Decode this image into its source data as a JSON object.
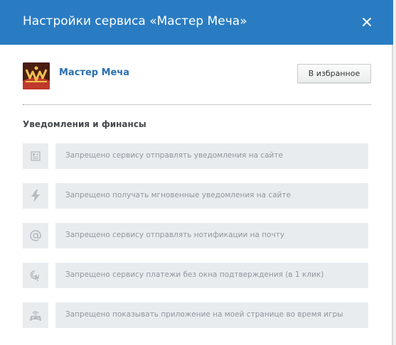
{
  "dialog": {
    "title": "Настройки сервиса «Мастер Меча»",
    "close_icon": "close-icon"
  },
  "app": {
    "name": "Мастер Меча",
    "logo_icon": "app-logo-icon",
    "favorite_label": "В избранное"
  },
  "section": {
    "title": "Уведомления и финансы"
  },
  "permissions": [
    {
      "icon": "notification-list-icon",
      "label": "Запрещено сервису отправлять уведомления на сайте"
    },
    {
      "icon": "lightning-icon",
      "label": "Запрещено получать мгновенные уведомления на сайте"
    },
    {
      "icon": "at-sign-icon",
      "label": "Запрещено сервису отправлять нотификации на почту"
    },
    {
      "icon": "one-click-payment-icon",
      "label": "Запрещено сервису платежи без окна подтверждения (в 1 клик)"
    },
    {
      "icon": "gamepad-icon",
      "label": "Запрещено показывать приложение на моей странице во время игры"
    }
  ],
  "colors": {
    "header": "#2a7cc2",
    "link": "#2a6fb0",
    "row_background": "#e9ecef",
    "row_text": "#8f969d",
    "icon": "#b5bbc1"
  }
}
